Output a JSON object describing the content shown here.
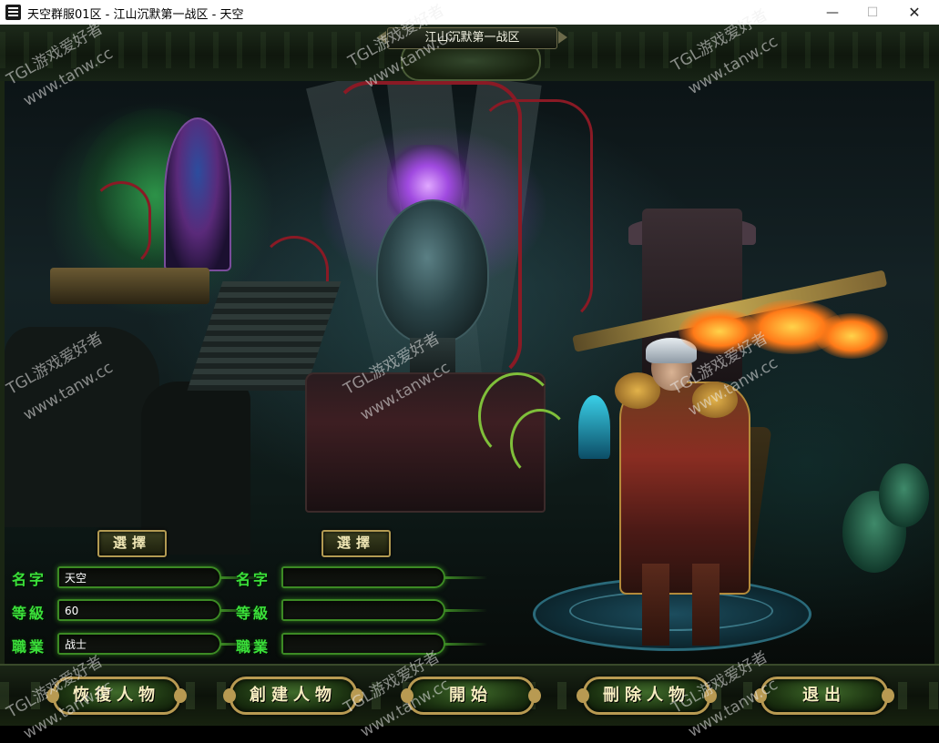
{
  "window": {
    "title": "天空群服01区 - 江山沉默第一战区 - 天空",
    "min_symbol": "—",
    "max_symbol": "☐",
    "close_symbol": "✕"
  },
  "server": {
    "name": "江山沉默第一战区"
  },
  "slots": [
    {
      "select_label": "選擇",
      "name_label": "名字",
      "name_value": "天空",
      "level_label": "等級",
      "level_value": "60",
      "job_label": "職業",
      "job_value": "战士"
    },
    {
      "select_label": "選擇",
      "name_label": "名字",
      "name_value": "",
      "level_label": "等級",
      "level_value": "",
      "job_label": "職業",
      "job_value": ""
    }
  ],
  "buttons": {
    "restore": "恢復人物",
    "create": "創建人物",
    "start": "開始",
    "delete": "刪除人物",
    "exit": "退出"
  },
  "watermark": {
    "site_name": "TGL游戏爱好者",
    "url": "www.tanw.cc"
  },
  "colors": {
    "label_green": "#3be03a",
    "button_gold": "#b89a52",
    "field_glow": "#3c8a24"
  }
}
